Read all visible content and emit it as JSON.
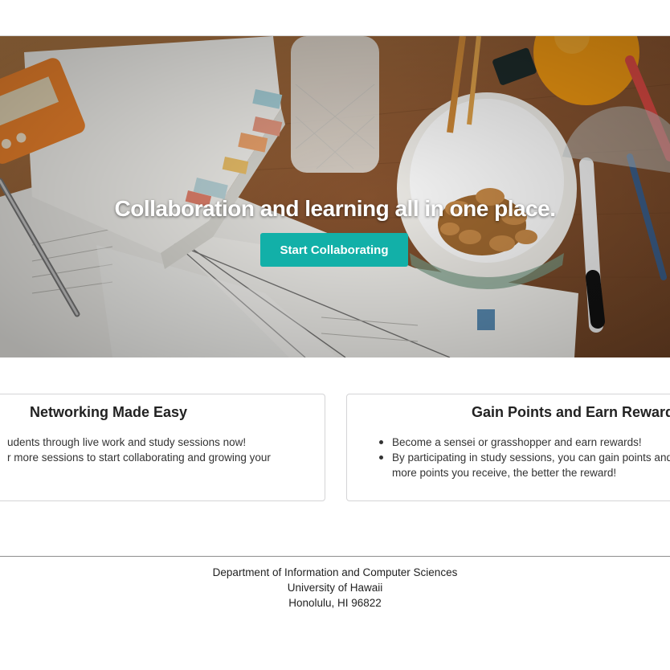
{
  "hero": {
    "title": "Collaboration and learning all in one place.",
    "cta_label": "Start Collaborating",
    "accent_color": "#12b0a8"
  },
  "cards": [
    {
      "title": "Networking Made Easy",
      "items": [
        "udents through live work and study sessions now!",
        "r more sessions to start collaborating and growing your"
      ]
    },
    {
      "title": "Gain Points and Earn Rewards",
      "items": [
        "Become a sensei or grasshopper and earn rewards!",
        "By participating in study sessions, you can gain points and",
        "more points you receive, the better the reward!"
      ]
    }
  ],
  "footer": {
    "line1": "Department of Information and Computer Sciences",
    "line2": "University of Hawaii",
    "line3": "Honolulu, HI 96822"
  }
}
